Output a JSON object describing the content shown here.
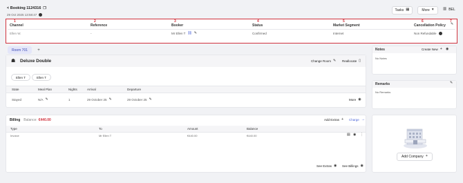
{
  "header": {
    "back_label": "< Booking 1124316",
    "datetime": "29 Oct 2025 13:58:47",
    "tasks_label": "Tasks",
    "more_label": "More",
    "bel_label": "BEL"
  },
  "summary": {
    "markers": [
      "1",
      "2",
      "3",
      "4",
      "5",
      "6",
      "7"
    ],
    "columns": [
      "Channel",
      "Reference",
      "Booker",
      "Status",
      "Market Segment",
      "Cancellation Policy"
    ],
    "values": [
      "Ellen W.",
      "-",
      "Mr Ellen T",
      "Confirmed",
      "Internet",
      "Non Refundable"
    ]
  },
  "room": {
    "tab_label": "Room 701",
    "add_tab": "+",
    "room_type": "Deluxe Double",
    "change_room": "Change Room",
    "reallocate": "Reallocate",
    "guests": [
      "Ellen T",
      "Ellen T"
    ],
    "table_headers": [
      "State",
      "Meal Plan",
      "Nights",
      "Arrival",
      "Departure"
    ],
    "row": [
      "Stayed",
      "N/A",
      "1",
      "29 October 25",
      "29 October 25"
    ],
    "more_label": "More"
  },
  "billing": {
    "title": "Billing",
    "balance_label": "Balance:",
    "balance_value": "€440.00",
    "add_extras": "Add Extras",
    "charge": "Charge",
    "headers": [
      "Type",
      "To",
      "Amount",
      "Balance"
    ],
    "row": [
      "Invoice",
      "Mr Ellen T",
      "€440.00",
      "€440.00"
    ],
    "see_extras": "See Extras",
    "see_billings": "See Billings"
  },
  "notes": {
    "title": "Notes",
    "create_new": "Create New",
    "empty": "No Notes"
  },
  "remarks": {
    "title": "Remarks",
    "empty": "No Remarks"
  },
  "company": {
    "add_label": "Add Company"
  },
  "colors": {
    "accent_red": "#d0313c",
    "link_blue": "#4a63d8",
    "page_bg": "#f1f2f5"
  }
}
